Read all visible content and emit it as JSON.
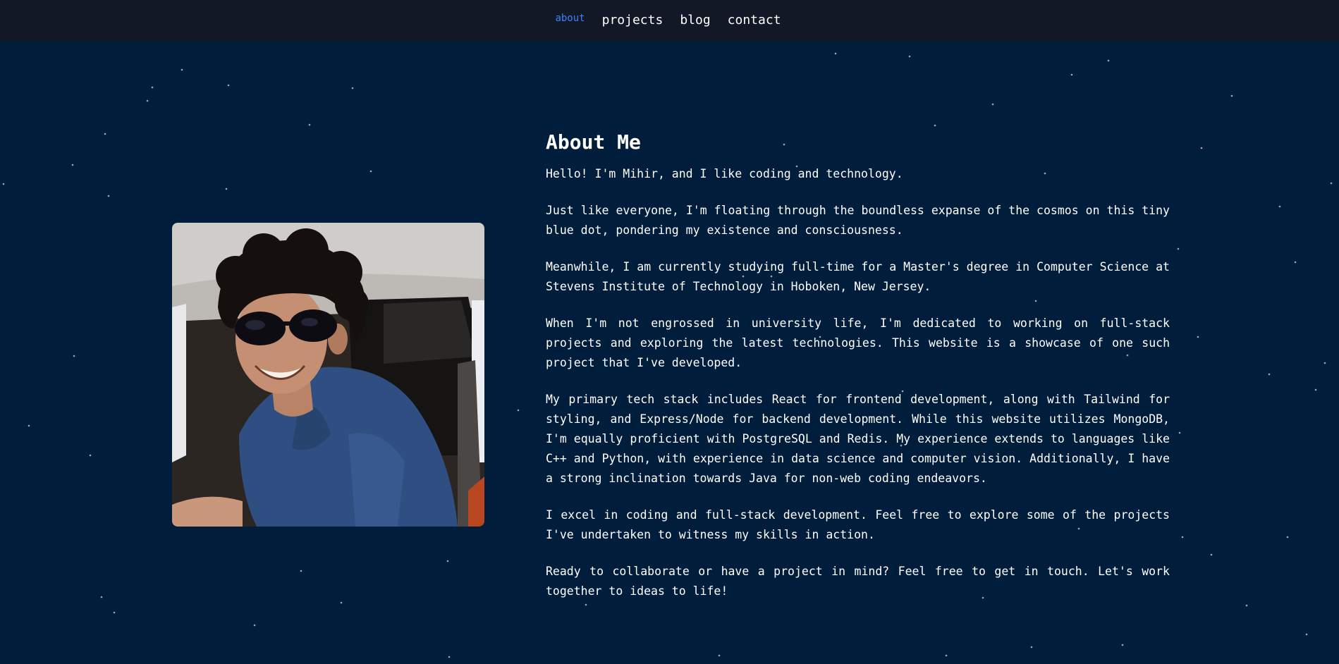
{
  "nav": {
    "items": [
      {
        "label": "about",
        "active": true
      },
      {
        "label": "projects",
        "active": false
      },
      {
        "label": "blog",
        "active": false
      },
      {
        "label": "contact",
        "active": false
      }
    ]
  },
  "about": {
    "title": "About Me",
    "paragraphs": [
      "Hello! I'm Mihir, and I like coding and technology.",
      "Just like everyone, I'm floating through the boundless expanse of the cosmos on this tiny blue dot, pondering my existence and consciousness.",
      "Meanwhile, I am currently studying full-time for a Master's degree in Computer Science at Stevens Institute of Technology in Hoboken, New Jersey.",
      "When I'm not engrossed in university life, I'm dedicated to working on full-stack projects and exploring the latest technologies. This website is a showcase of one such project that I've developed.",
      "My primary tech stack includes React for frontend development, along with Tailwind for styling, and Express/Node for backend development. While this website utilizes MongoDB, I'm equally proficient with PostgreSQL and Redis. My experience extends to languages like C++ and Python, with experience in data science and computer vision. Additionally, I have a strong inclination towards Java for non-web coding endeavors.",
      "I excel in coding and full-stack development. Feel free to explore some of the projects I've undertaken to witness my skills in action.",
      "Ready to collaborate or have a project in mind? Feel free to get in touch. Let's work together to ideas to life!"
    ]
  },
  "colors": {
    "background": "#001e3c",
    "topbar": "#121826",
    "nav_active": "#3b82f6",
    "text": "#ffffff"
  }
}
